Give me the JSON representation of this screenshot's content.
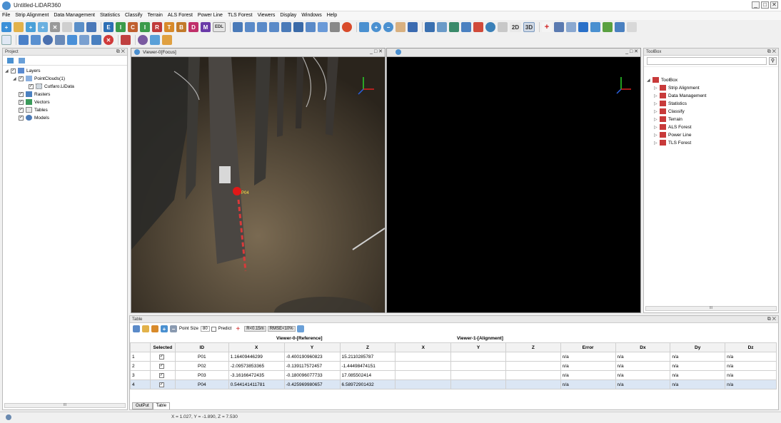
{
  "window": {
    "title": "Untitled-LiDAR360",
    "minimize": "_",
    "maximize": "□",
    "close": "✕"
  },
  "menu": [
    "File",
    "Strip Alignment",
    "Data Management",
    "Statistics",
    "Classify",
    "Terrain",
    "ALS Forest",
    "Power Line",
    "TLS Forest",
    "Viewers",
    "Display",
    "Windows",
    "Help"
  ],
  "toolbar": {
    "letter_buttons": [
      "E",
      "I",
      "C",
      "I",
      "R",
      "T",
      "B",
      "D",
      "M",
      "EDL"
    ],
    "view_2d": "2D",
    "view_3d": "3D"
  },
  "project": {
    "title": "Project",
    "items": [
      {
        "label": "Layers",
        "level": 0
      },
      {
        "label": "PointClouds(1)",
        "level": 1
      },
      {
        "label": "Cutfaro.LiData",
        "level": 2
      },
      {
        "label": "Rasters",
        "level": 1
      },
      {
        "label": "Vectors",
        "level": 1
      },
      {
        "label": "Tables",
        "level": 1
      },
      {
        "label": "Models",
        "level": 1
      }
    ],
    "scroll_label": "III"
  },
  "viewer0": {
    "title": "Viewer-0[Focus]",
    "marker_label": "P04"
  },
  "toolbox": {
    "title": "ToolBox",
    "root": "ToolBox",
    "items": [
      "Strip Alignment",
      "Data Management",
      "Statistics",
      "Classify",
      "Terrain",
      "ALS Forest",
      "Power Line",
      "TLS Forest"
    ],
    "scroll_label": "III"
  },
  "table_panel": {
    "title": "Table",
    "point_size_label": "Point Size",
    "point_size_value": "80",
    "predict_label": "Predict",
    "snap_label": "R<0.15m",
    "rmse_label": "RMSE<10%",
    "group_reference": "Viewer-0-[Reference]",
    "group_alignment": "Viewer-1-[Alignment]",
    "headers": [
      "",
      "Selected",
      "ID",
      "X",
      "Y",
      "Z",
      "X",
      "Y",
      "Z",
      "Error",
      "Dx",
      "Dy",
      "Dz"
    ],
    "rows": [
      {
        "n": "1",
        "id": "P01",
        "x": "1.16409446299",
        "y": "-0.400190960823",
        "z": "15.2110285787",
        "x2": "",
        "y2": "",
        "z2": "",
        "err": "n/a",
        "dx": "n/a",
        "dy": "n/a",
        "dz": "n/a"
      },
      {
        "n": "2",
        "id": "P02",
        "x": "-2.09573853365",
        "y": "-0.139117572457",
        "z": "-1.44498474151",
        "x2": "",
        "y2": "",
        "z2": "",
        "err": "n/a",
        "dx": "n/a",
        "dy": "n/a",
        "dz": "n/a"
      },
      {
        "n": "3",
        "id": "P03",
        "x": "-3.16166472435",
        "y": "-0.180096077733",
        "z": "17.085502414",
        "x2": "",
        "y2": "",
        "z2": "",
        "err": "n/a",
        "dx": "n/a",
        "dy": "n/a",
        "dz": "n/a"
      },
      {
        "n": "4",
        "id": "P04",
        "x": "0.544141411781",
        "y": "-0.425969980657",
        "z": "6.58972901432",
        "x2": "",
        "y2": "",
        "z2": "",
        "err": "n/a",
        "dx": "n/a",
        "dy": "n/a",
        "dz": "n/a"
      }
    ],
    "tabs": [
      "OutPut",
      "Table"
    ]
  },
  "status": {
    "coords": "X = 1.027, Y = -1.890, Z = 7.530"
  },
  "colors": {
    "accent": "#3a6fb0",
    "selected_row": "#dbe6f4",
    "marker": "#e01818"
  }
}
